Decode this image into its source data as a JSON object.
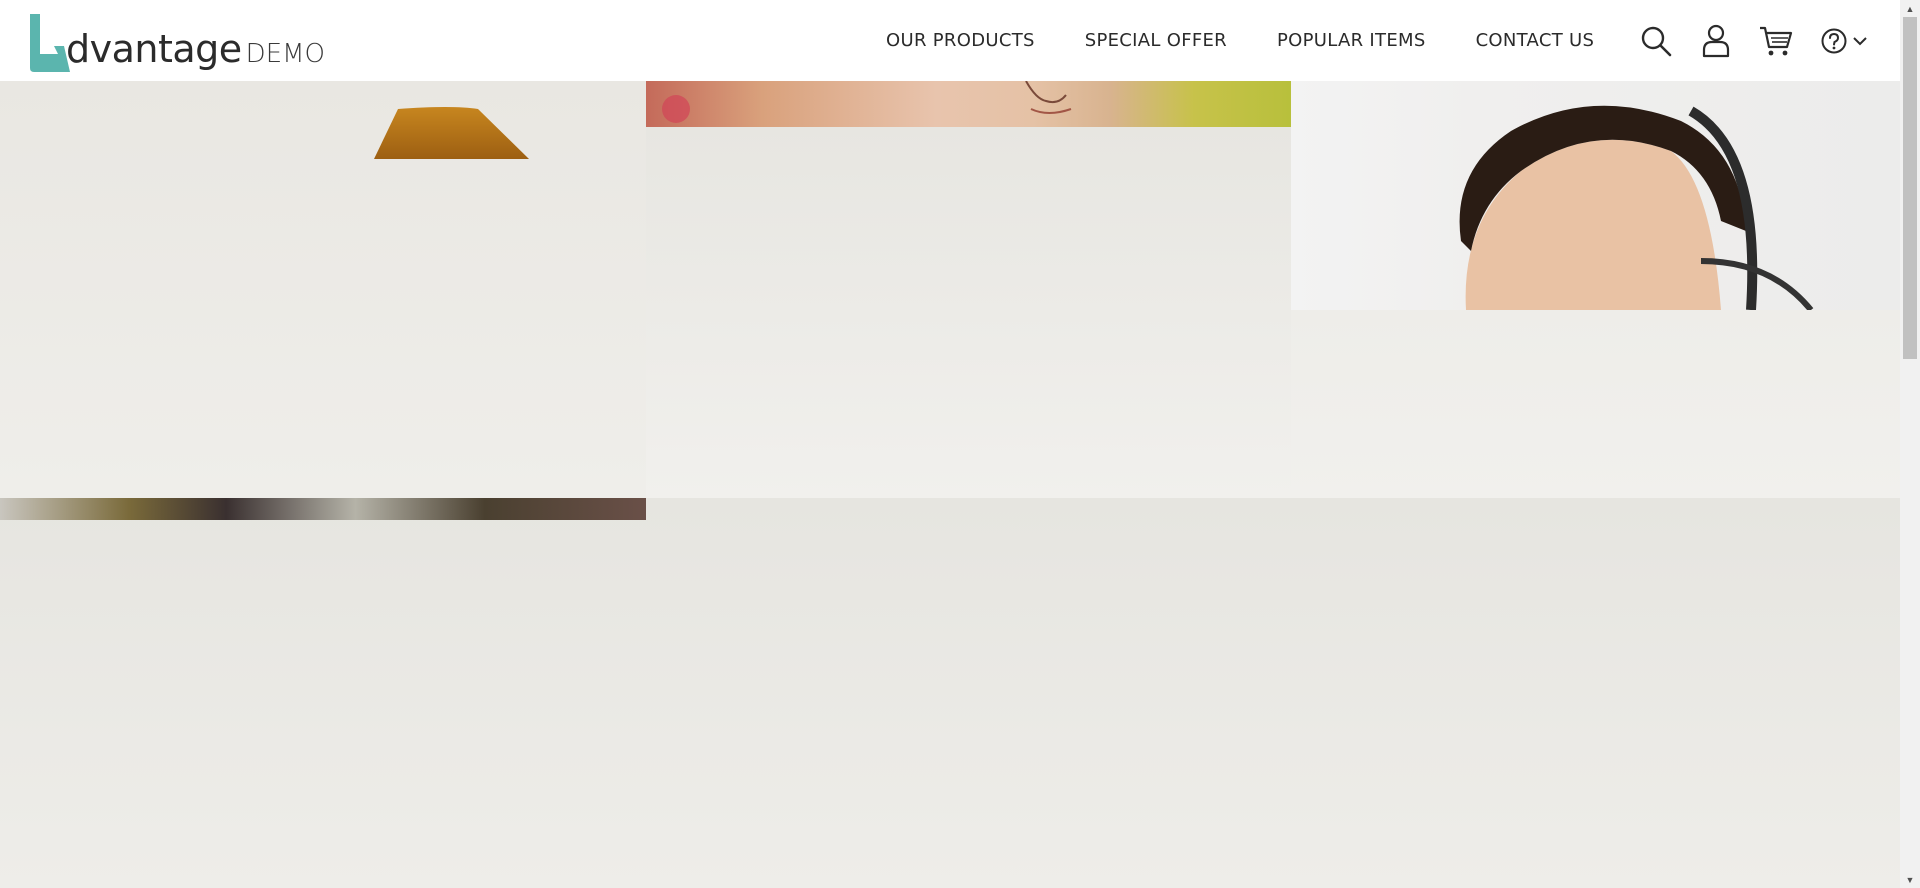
{
  "brand": {
    "name": "dvantage",
    "suffix": "DEMO",
    "accent": "#5bb5ae"
  },
  "nav": {
    "items": [
      {
        "label": "OUR PRODUCTS"
      },
      {
        "label": "SPECIAL OFFER"
      },
      {
        "label": "POPULAR ITEMS"
      },
      {
        "label": "CONTACT US"
      }
    ]
  },
  "icons": {
    "search": "search-icon",
    "user": "user-icon",
    "cart": "cart-icon",
    "help": "help-icon",
    "dropdown": "chevron-down-icon"
  },
  "colors": {
    "header_bg": "#ffffff",
    "text": "#2b2b2b",
    "page_bg": "#efeeeb",
    "lamp": "#b5741a"
  }
}
